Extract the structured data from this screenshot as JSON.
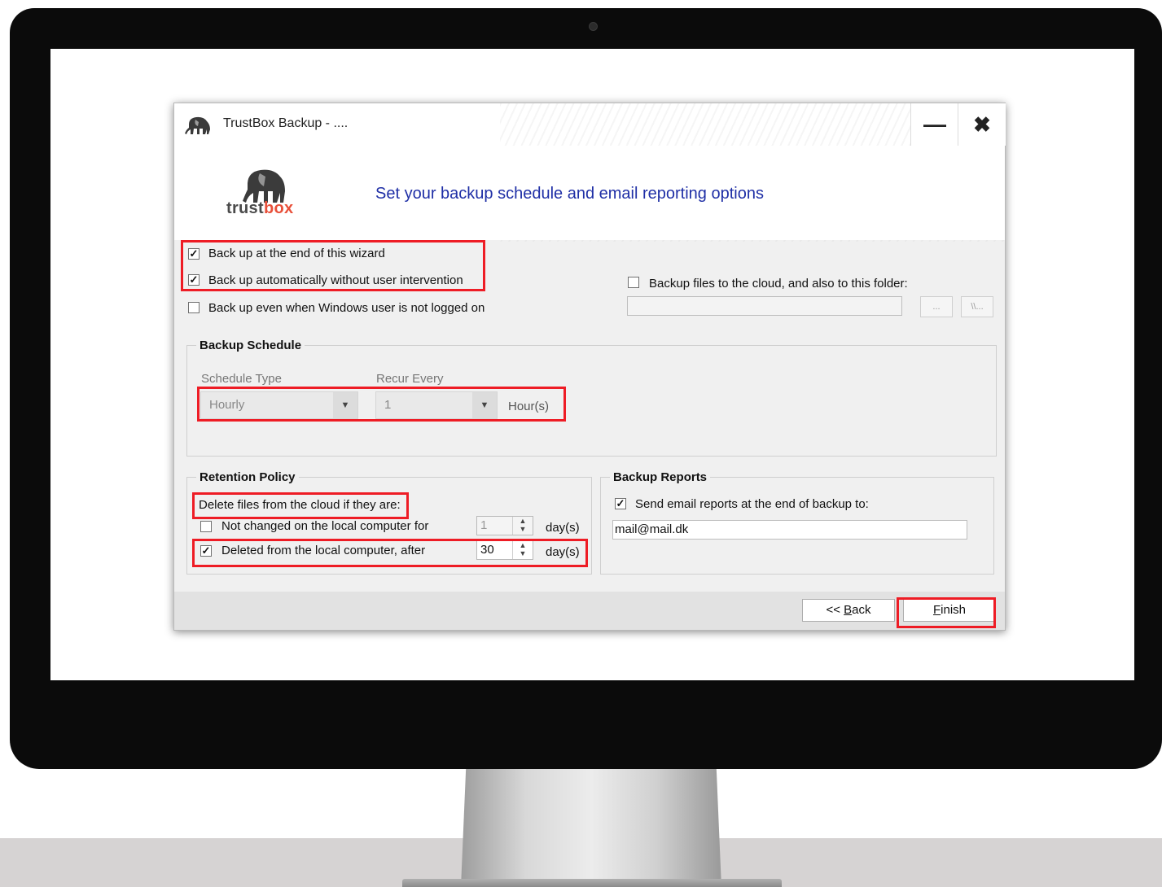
{
  "window": {
    "title": "TrustBox Backup  -  ....",
    "minimize_icon": "minimize-icon",
    "close_icon": "close-icon"
  },
  "header": {
    "logo_word_1": "trust",
    "logo_word_2": "box",
    "heading": "Set your backup schedule and email reporting options"
  },
  "options": {
    "backup_end_wizard": {
      "label": "Back up at the end of this wizard",
      "checked": true
    },
    "backup_auto": {
      "label": "Back up automatically without user intervention",
      "checked": true
    },
    "backup_not_logged": {
      "label": "Back up even when Windows user is not logged on",
      "checked": false
    },
    "backup_folder": {
      "label": "Backup files to the cloud, and also to this folder:",
      "checked": false,
      "value": ""
    },
    "browse_button_1": "...",
    "browse_button_2": "\\\\..."
  },
  "schedule": {
    "group_title": "Backup Schedule",
    "type_label": "Schedule Type",
    "type_value": "Hourly",
    "recur_label": "Recur Every",
    "recur_value": "1",
    "unit": "Hour(s)"
  },
  "retention": {
    "group_title": "Retention Policy",
    "intro": "Delete files from the cloud if they are:",
    "not_changed": {
      "label": "Not changed on the local computer for",
      "checked": false,
      "days": "1",
      "unit": "day(s)"
    },
    "deleted": {
      "label": "Deleted from the local computer, after",
      "checked": true,
      "days": "30",
      "unit": "day(s)"
    }
  },
  "reports": {
    "group_title": "Backup Reports",
    "send_email": {
      "label": "Send email reports at the end of backup to:",
      "checked": true
    },
    "email_value": "mail@mail.dk"
  },
  "footer": {
    "back_prefix": "<< ",
    "back_mnemonic": "B",
    "back_rest": "ack",
    "finish_mnemonic": "F",
    "finish_rest": "inish"
  },
  "colors": {
    "highlight": "#ee1c25",
    "heading": "#1f2fa6",
    "logo_accent": "#e8503a"
  }
}
